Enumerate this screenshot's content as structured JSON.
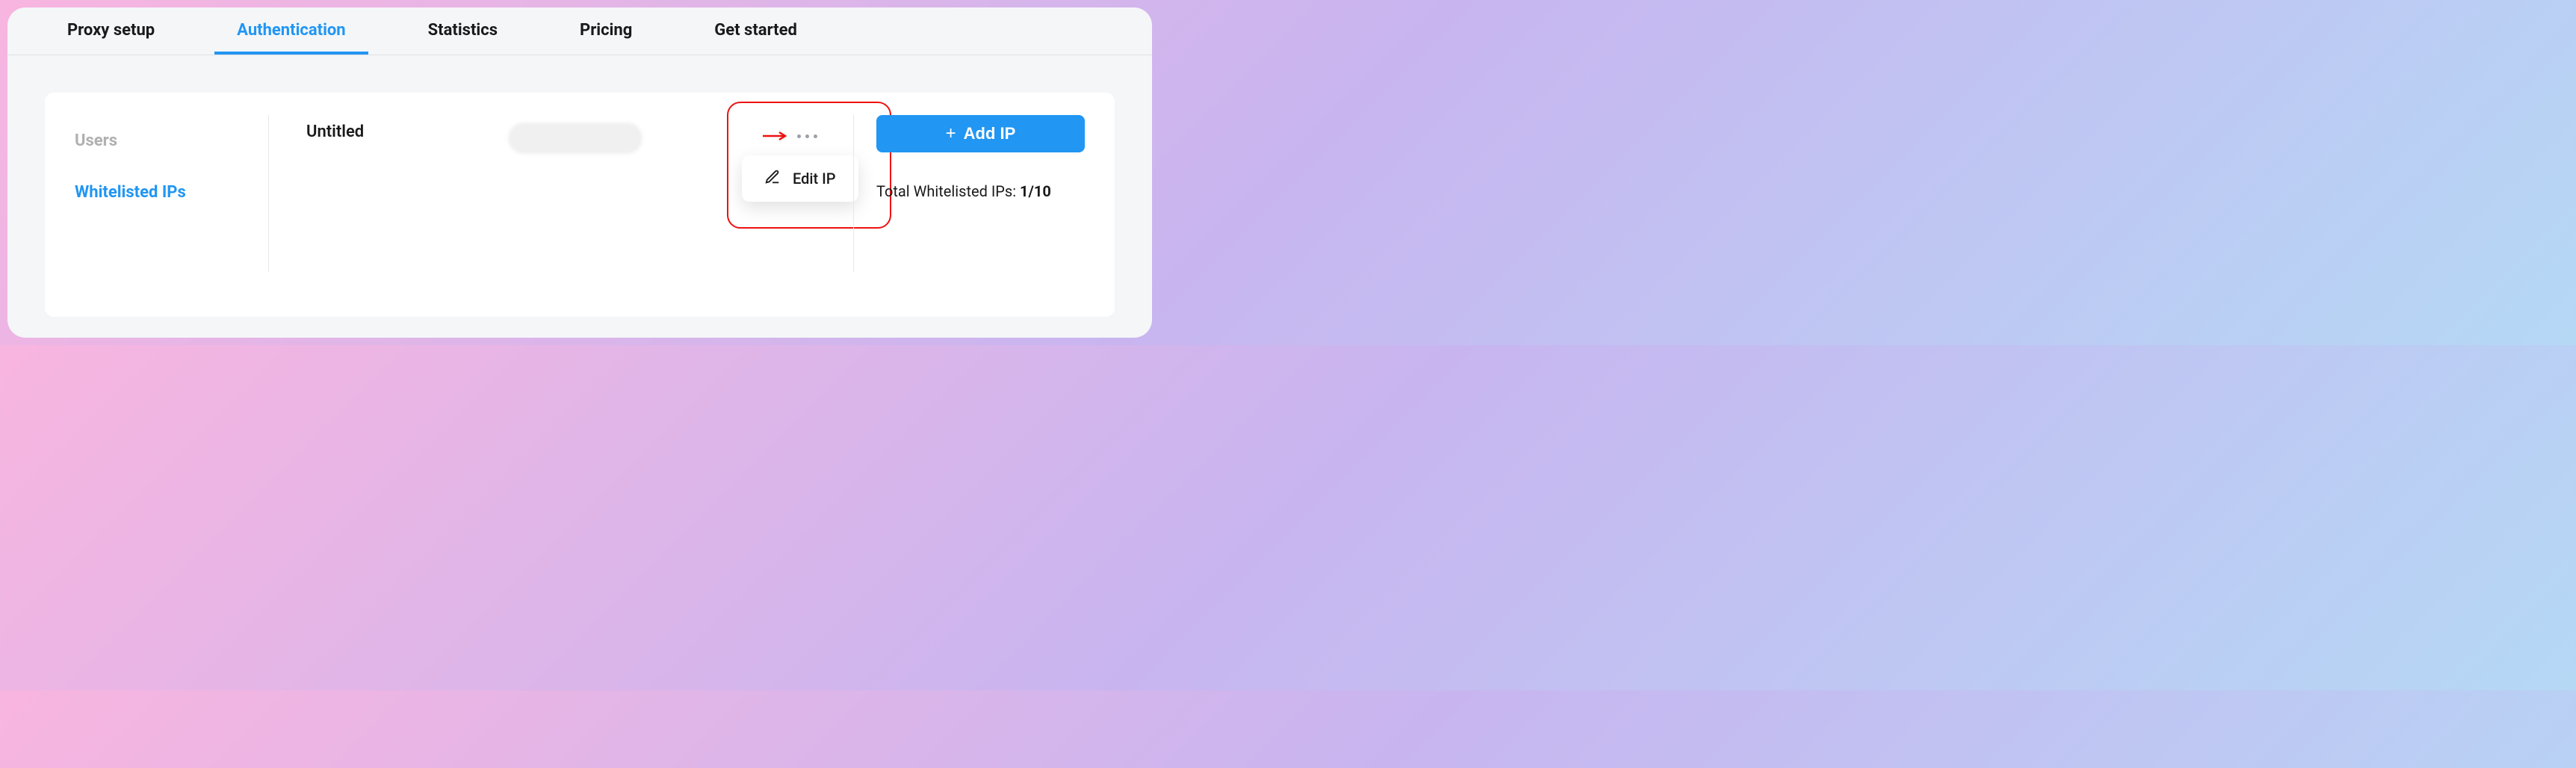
{
  "tabs": [
    {
      "label": "Proxy setup"
    },
    {
      "label": "Authentication"
    },
    {
      "label": "Statistics"
    },
    {
      "label": "Pricing"
    },
    {
      "label": "Get started"
    }
  ],
  "active_tab_index": 1,
  "side_tabs": [
    {
      "label": "Users"
    },
    {
      "label": "Whitelisted IPs"
    }
  ],
  "active_side_tab_index": 1,
  "row": {
    "name": "Untitled"
  },
  "dropdown": {
    "edit_label": "Edit IP"
  },
  "add_button_label": "Add IP",
  "total": {
    "label": "Total Whitelisted IPs: ",
    "count": "1/10"
  }
}
